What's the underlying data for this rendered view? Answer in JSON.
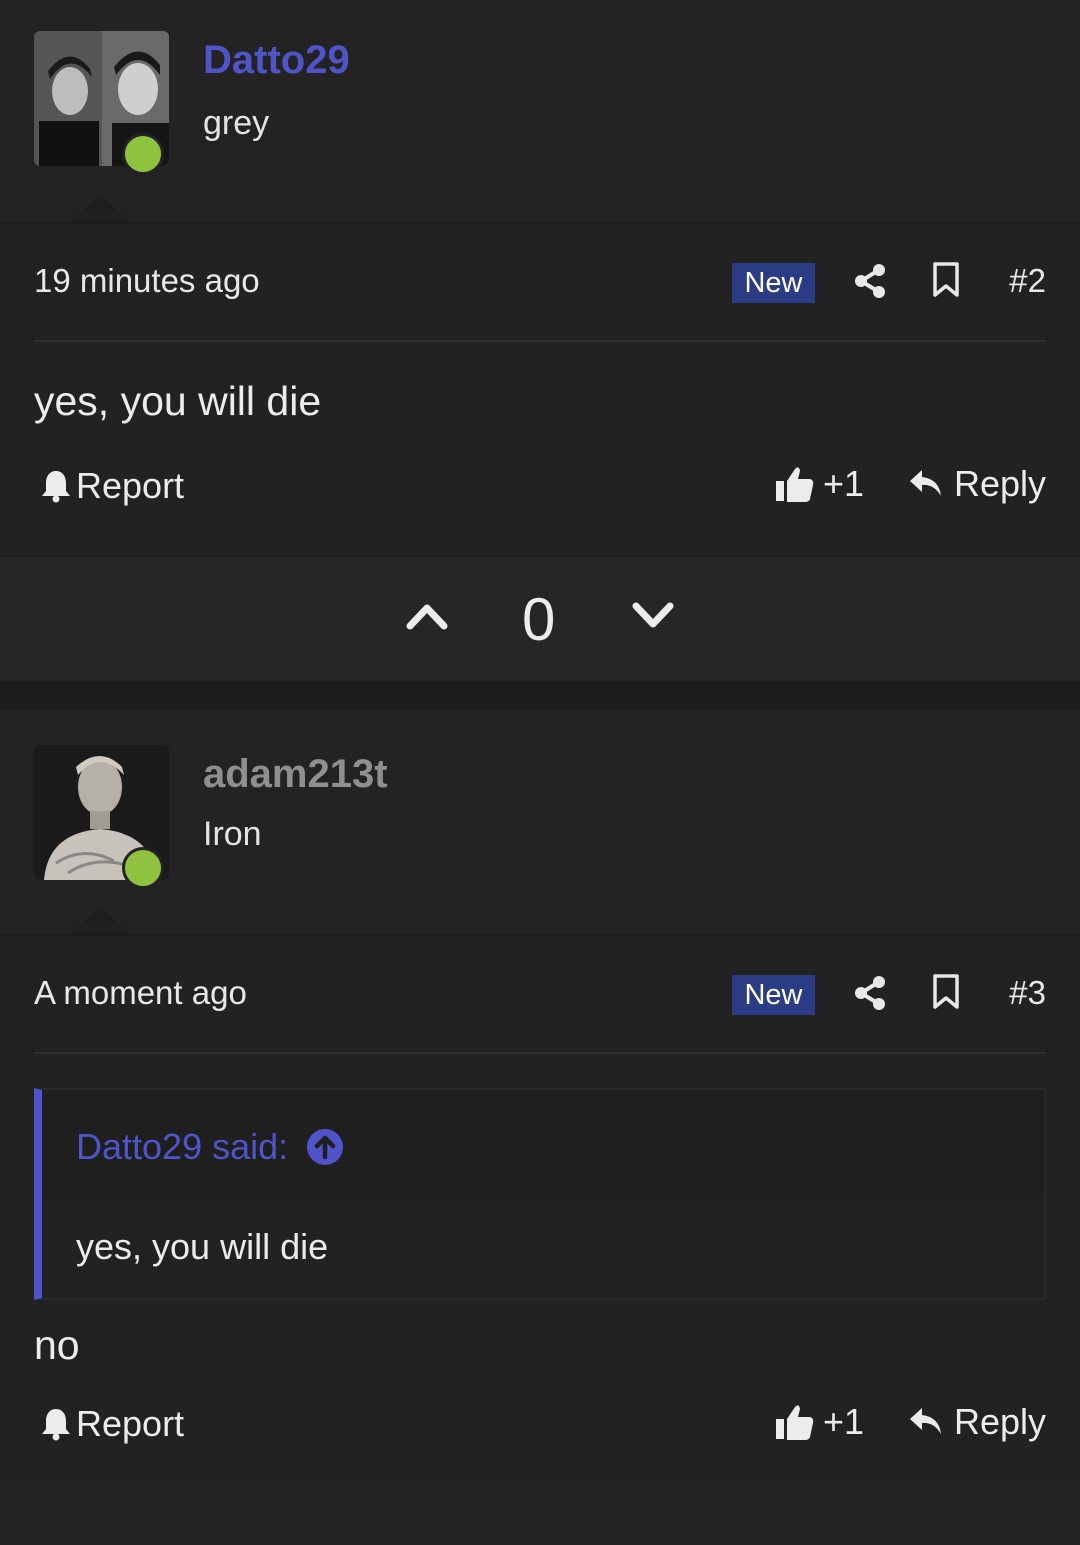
{
  "posts": [
    {
      "username": "Datto29",
      "user_title": "grey",
      "timestamp": "19 minutes ago",
      "badge": "New",
      "post_number": "#2",
      "message": "yes, you will die",
      "report_label": "Report",
      "like_label": "+1",
      "reply_label": "Reply",
      "vote_count": "0"
    },
    {
      "username": "adam213t",
      "user_title": "Iron",
      "timestamp": "A moment ago",
      "badge": "New",
      "post_number": "#3",
      "quote": {
        "author": "Datto29 said:",
        "text": "yes, you will die"
      },
      "message": "no",
      "report_label": "Report",
      "like_label": "+1",
      "reply_label": "Reply"
    }
  ],
  "colors": {
    "background": "#232323",
    "accent": "#4f55c8",
    "badge": "#2c3c84",
    "online": "#8fc23f"
  },
  "icons": [
    "share-icon",
    "bookmark-icon",
    "bell-icon",
    "thumbs-up-icon",
    "reply-arrow-icon",
    "chevron-up-icon",
    "chevron-down-icon",
    "arrow-up-circle-icon"
  ]
}
